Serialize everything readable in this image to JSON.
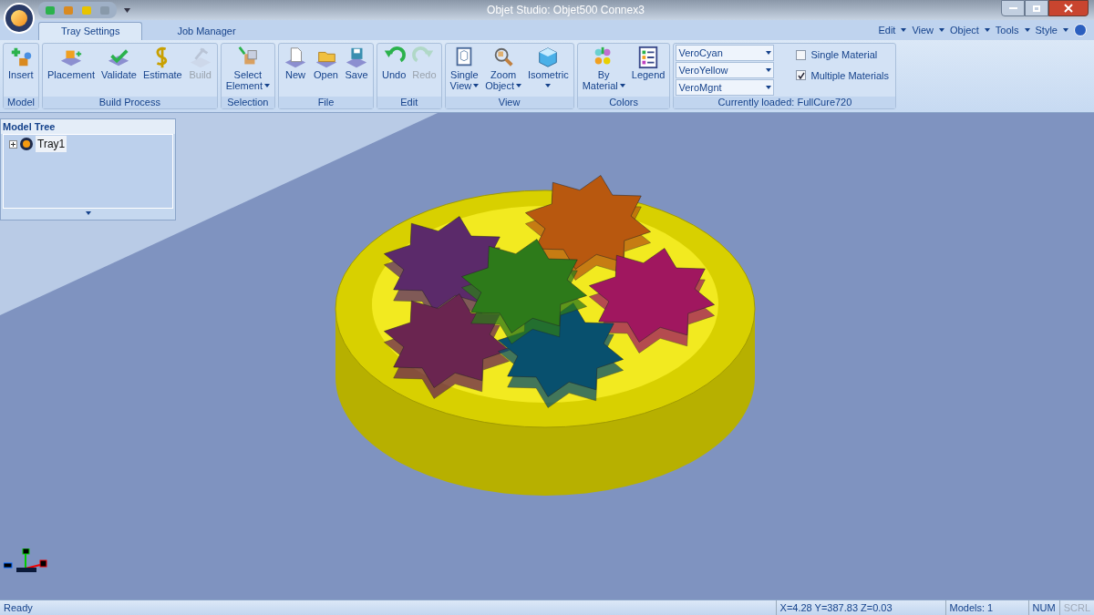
{
  "window": {
    "title": "Objet Studio: Objet500 Connex3"
  },
  "menu": [
    "Edit",
    "View",
    "Object",
    "Tools",
    "Style"
  ],
  "tabs": [
    {
      "label": "Tray Settings",
      "selected": true
    },
    {
      "label": "Job Manager",
      "selected": false
    }
  ],
  "ribbon_groups": [
    {
      "label": "Model",
      "buttons": [
        {
          "label": "Insert",
          "disabled": false
        }
      ]
    },
    {
      "label": "Build Process",
      "buttons": [
        {
          "label": "Placement",
          "disabled": false
        },
        {
          "label": "Validate",
          "disabled": false
        },
        {
          "label": "Estimate",
          "disabled": false
        },
        {
          "label": "Build",
          "disabled": true
        }
      ]
    },
    {
      "label": "Selection",
      "buttons": [
        {
          "label": "Select",
          "label2": "Element",
          "disabled": false,
          "menu": true
        }
      ]
    },
    {
      "label": "File",
      "buttons": [
        {
          "label": "New",
          "disabled": false
        },
        {
          "label": "Open",
          "disabled": false
        },
        {
          "label": "Save",
          "disabled": false
        }
      ]
    },
    {
      "label": "Edit",
      "buttons": [
        {
          "label": "Undo",
          "disabled": false
        },
        {
          "label": "Redo",
          "disabled": true
        }
      ]
    },
    {
      "label": "View",
      "buttons": [
        {
          "label": "Single",
          "label2": "View",
          "disabled": false,
          "menu": true
        },
        {
          "label": "Zoom",
          "label2": "Object",
          "disabled": false,
          "menu": true
        },
        {
          "label": "Isometric",
          "disabled": false,
          "menu": true
        }
      ]
    },
    {
      "label": "Colors",
      "buttons": [
        {
          "label": "By",
          "label2": "Material",
          "disabled": false,
          "menu": true
        },
        {
          "label": "Legend",
          "disabled": false
        }
      ]
    }
  ],
  "materials": {
    "label": "Currently loaded: FullCure720",
    "dropdowns": [
      "VeroCyan",
      "VeroYellow",
      "VeroMgnt"
    ],
    "options": [
      {
        "label": "Single Material",
        "checked": false
      },
      {
        "label": "Multiple Materials",
        "checked": true
      }
    ]
  },
  "model_tree": {
    "title": "Model Tree",
    "items": [
      {
        "label": "Tray1",
        "expanded": false
      }
    ]
  },
  "status_bar": {
    "message": "Ready",
    "coordinates": "X=4.28 Y=387.83 Z=0.03",
    "models": "Models: 1",
    "indicators": [
      {
        "label": "NUM",
        "on": true
      },
      {
        "label": "SCRL",
        "on": false
      }
    ]
  }
}
